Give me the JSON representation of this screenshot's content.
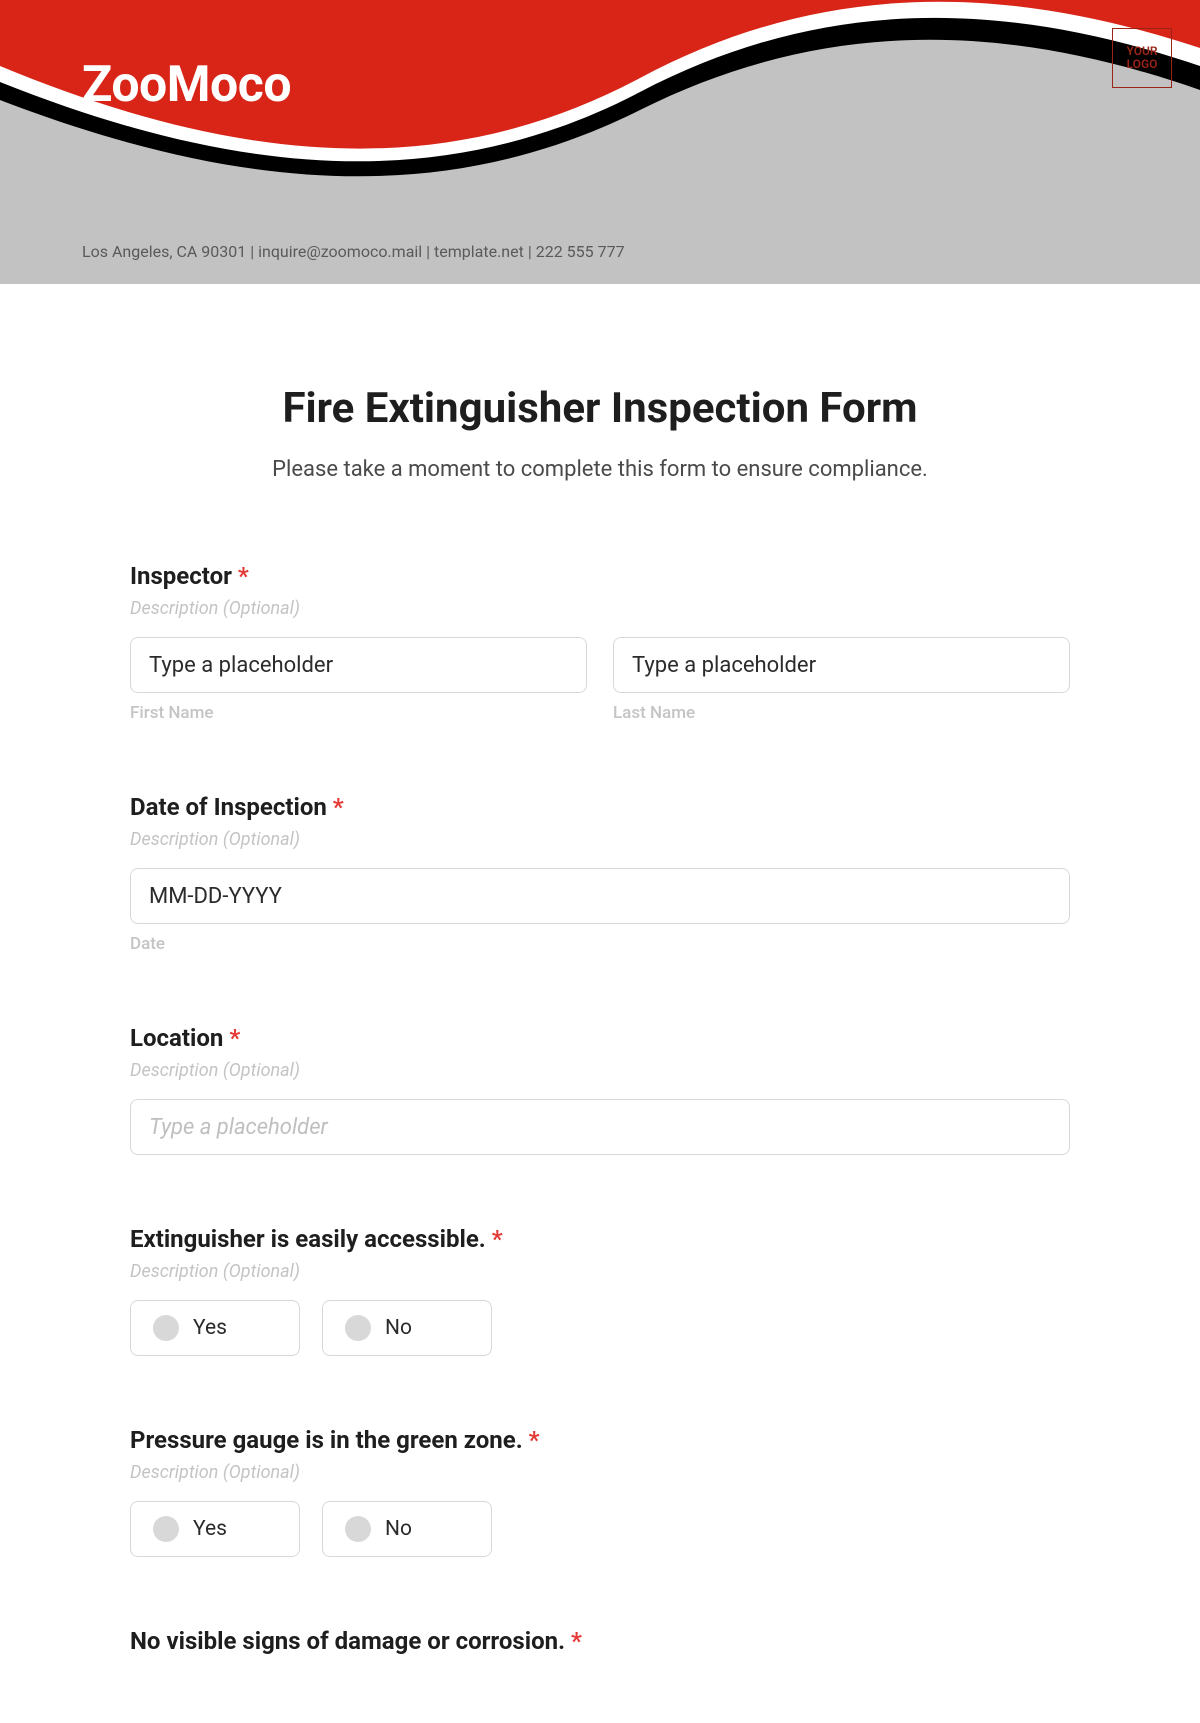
{
  "header": {
    "brand": "ZooMoco",
    "logo_text": "YOUR\nLOGO",
    "contact_line": "Los Angeles, CA 90301 | inquire@zoomoco.mail | template.net | 222 555 777"
  },
  "form": {
    "title": "Fire Extinguisher Inspection Form",
    "subtitle": "Please take a moment to complete this form to ensure compliance."
  },
  "fields": {
    "inspector": {
      "label": "Inspector",
      "desc": "Description (Optional)",
      "first_placeholder": "Type a placeholder",
      "last_placeholder": "Type a placeholder",
      "first_sub": "First Name",
      "last_sub": "Last Name"
    },
    "date": {
      "label": "Date of Inspection",
      "desc": "Description (Optional)",
      "placeholder": "MM-DD-YYYY",
      "sub": "Date"
    },
    "location": {
      "label": "Location",
      "desc": "Description (Optional)",
      "placeholder": "Type a placeholder"
    },
    "accessible": {
      "label": "Extinguisher is easily accessible.",
      "desc": "Description (Optional)",
      "yes": "Yes",
      "no": "No"
    },
    "pressure": {
      "label": "Pressure gauge is in the green zone.",
      "desc": "Description (Optional)",
      "yes": "Yes",
      "no": "No"
    },
    "damage": {
      "label": "No visible signs of damage or corrosion."
    }
  }
}
